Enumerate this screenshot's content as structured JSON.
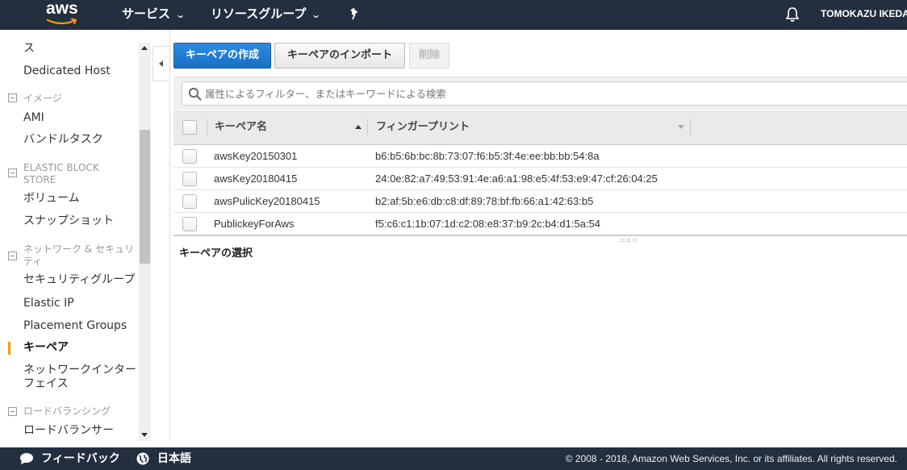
{
  "topnav": {
    "logo_text": "aws",
    "services_label": "サービス",
    "resource_groups_label": "リソースグループ",
    "user_label": "TOMOKAZU IKEDA"
  },
  "sidebar": {
    "items": [
      {
        "type": "item",
        "label": "ス"
      },
      {
        "type": "item",
        "label": "Dedicated Host"
      },
      {
        "type": "section",
        "label": "イメージ"
      },
      {
        "type": "item",
        "label": "AMI"
      },
      {
        "type": "item",
        "label": "バンドルタスク"
      },
      {
        "type": "section",
        "label": "ELASTIC BLOCK",
        "label2": "STORE"
      },
      {
        "type": "item",
        "label": "ボリューム"
      },
      {
        "type": "item",
        "label": "スナップショット"
      },
      {
        "type": "section",
        "label": "ネットワーク & セキュリ",
        "label2": "ティ"
      },
      {
        "type": "item",
        "label": "セキュリティグループ"
      },
      {
        "type": "item",
        "label": "Elastic IP"
      },
      {
        "type": "item",
        "label": "Placement Groups"
      },
      {
        "type": "item",
        "label": "キーペア",
        "active": true
      },
      {
        "type": "item",
        "label": "ネットワークインター",
        "label2": "フェイス"
      },
      {
        "type": "section",
        "label": "ロードバランシング"
      },
      {
        "type": "item",
        "label": "ロードバランサー"
      }
    ]
  },
  "toolbar": {
    "create_label": "キーペアの作成",
    "import_label": "キーペアのインポート",
    "delete_label": "削除"
  },
  "search": {
    "placeholder": "属性によるフィルター、またはキーワードによる検索"
  },
  "table": {
    "columns": [
      "キーペア名",
      "フィンガープリント"
    ],
    "rows": [
      {
        "name": "awsKey20150301",
        "fingerprint": "b6:b5:6b:bc:8b:73:07:f6:b5:3f:4e:ee:bb:bb:54:8a"
      },
      {
        "name": "awsKey20180415",
        "fingerprint": "24:0e:82:a7:49:53:91:4e:a6:a1:98:e5:4f:53:e9:47:cf:26:04:25"
      },
      {
        "name": "awsPulicKey20180415",
        "fingerprint": "b2:af:5b:e6:db:c8:df:89:78:bf:fb:66:a1:42:63:b5"
      },
      {
        "name": "PublickeyForAws",
        "fingerprint": "f5:c6:c1:1b:07:1d:c2:08:e8:37:b9:2c:b4:d1:5a:54"
      }
    ]
  },
  "detail": {
    "title": "キーペアの選択"
  },
  "footer": {
    "feedback_label": "フィードバック",
    "language_label": "日本語",
    "copyright": "© 2008 - 2018, Amazon Web Services, Inc. or its affiliates. All rights reserved."
  },
  "icons": {
    "logo": "aws-logo-icon",
    "pin": "pin-icon",
    "bell": "bell-icon",
    "search": "search-icon",
    "feedback": "speech-bubble-icon",
    "globe": "globe-icon"
  },
  "colors": {
    "nav_bg": "#232f3e",
    "primary": "#1a6fc4",
    "active_indicator": "#ff9900"
  }
}
